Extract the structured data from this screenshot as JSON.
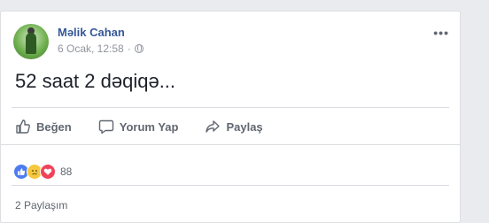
{
  "post": {
    "author": "Məlik Cahan",
    "timestamp": "6 Ocak, 12:58",
    "separator": "·",
    "audience_icon": "globe-icon",
    "more_label": "•••",
    "text": "52 saat 2 dəqiqə..."
  },
  "actions": {
    "like_label": "Beğen",
    "comment_label": "Yorum Yap",
    "share_label": "Paylaş"
  },
  "reactions": {
    "types": [
      "like-icon",
      "sad-icon",
      "love-icon"
    ],
    "count": "88",
    "colors": {
      "like": "#4e7cf0",
      "sad": "#f7c83c",
      "love": "#f0435a"
    }
  },
  "shares": {
    "label": "2 Paylaşım"
  },
  "theme": {
    "link_color": "#365899",
    "muted_color": "#90949c",
    "action_color": "#606770"
  }
}
